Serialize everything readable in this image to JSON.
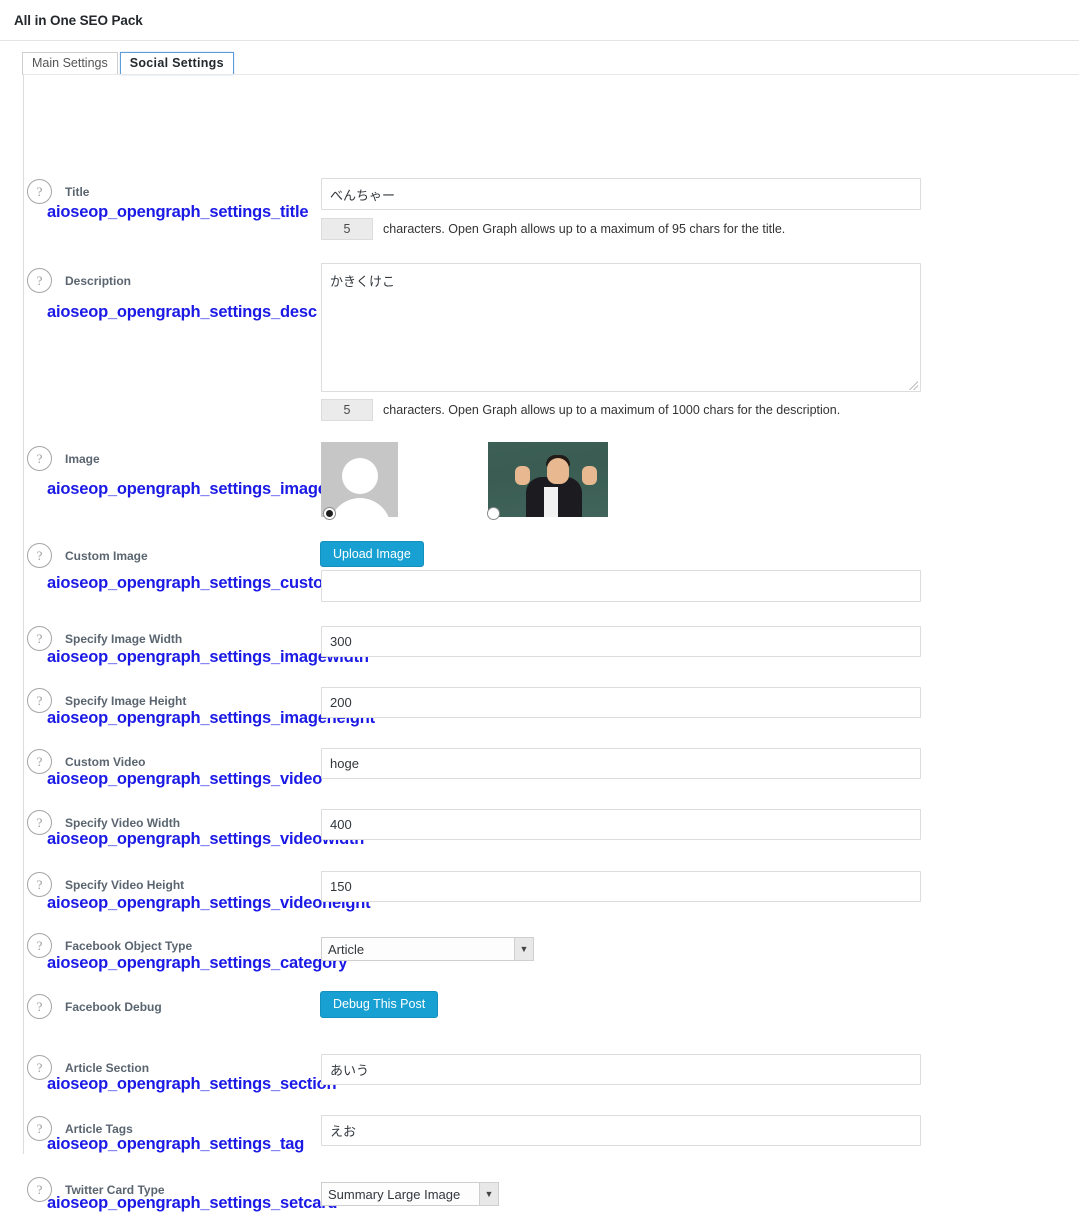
{
  "header": {
    "title": "All in One SEO Pack"
  },
  "tabs": [
    {
      "label": "Main Settings",
      "active": false
    },
    {
      "label": "Social Settings",
      "active": true
    }
  ],
  "colors": {
    "accent_button": "#18a0d2",
    "active_tab_border": "#5b9dd9",
    "option_name": "#1a19e6"
  },
  "fields": {
    "title": {
      "label": "Title",
      "option_name": "aioseop_opengraph_settings_title",
      "value": "べんちゃー",
      "counter": "5",
      "counter_note": "characters. Open Graph allows up to a maximum of 95 chars for the title."
    },
    "description": {
      "label": "Description",
      "option_name": "aioseop_opengraph_settings_desc",
      "value": "かきくけこ",
      "counter": "5",
      "counter_note": "characters. Open Graph allows up to a maximum of 1000 chars for the description."
    },
    "image": {
      "label": "Image",
      "option_name": "aioseop_opengraph_settings_image",
      "choices": [
        {
          "name": "default-avatar-thumbnail",
          "selected": true
        },
        {
          "name": "featured-photo-thumbnail",
          "selected": false
        }
      ]
    },
    "custom_image": {
      "label": "Custom Image",
      "option_name": "aioseop_opengraph_settings_customimg",
      "upload_button": "Upload Image",
      "value": ""
    },
    "image_width": {
      "label": "Specify Image Width",
      "option_name": "aioseop_opengraph_settings_imagewidth",
      "value": "300"
    },
    "image_height": {
      "label": "Specify Image Height",
      "option_name": "aioseop_opengraph_settings_imageheight",
      "value": "200"
    },
    "custom_video": {
      "label": "Custom Video",
      "option_name": "aioseop_opengraph_settings_video",
      "value": "hoge"
    },
    "video_width": {
      "label": "Specify Video Width",
      "option_name": "aioseop_opengraph_settings_videowidth",
      "value": "400"
    },
    "video_height": {
      "label": "Specify Video Height",
      "option_name": "aioseop_opengraph_settings_videoheight",
      "value": "150"
    },
    "facebook_object_type": {
      "label": "Facebook Object Type",
      "option_name": "aioseop_opengraph_settings_category",
      "value": "Article"
    },
    "facebook_debug": {
      "label": "Facebook Debug",
      "button": "Debug This Post"
    },
    "article_section": {
      "label": "Article Section",
      "option_name": "aioseop_opengraph_settings_section",
      "value": "あいう"
    },
    "article_tags": {
      "label": "Article Tags",
      "option_name": "aioseop_opengraph_settings_tag",
      "value": "えお"
    },
    "twitter_card_type": {
      "label": "Twitter Card Type",
      "option_name": "aioseop_opengraph_settings_setcard",
      "value": "Summary Large Image"
    }
  },
  "icons": {
    "help": "?",
    "chevron_down": "▼"
  }
}
